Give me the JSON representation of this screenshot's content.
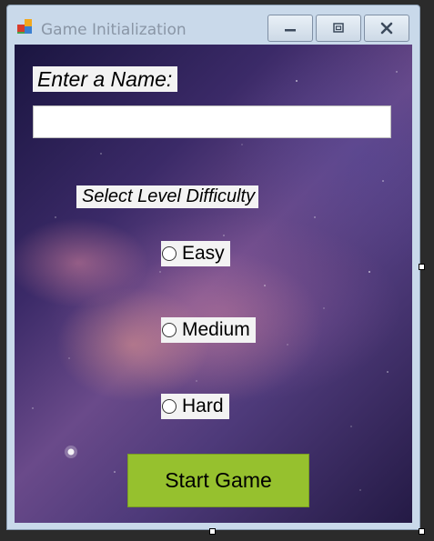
{
  "window": {
    "title": "Game Initialization",
    "icon": "winforms-app-icon",
    "controls": [
      "minimize-icon",
      "maximize-icon",
      "close-icon"
    ]
  },
  "form": {
    "name_label": "Enter a Name:",
    "name_input": {
      "value": "",
      "placeholder": ""
    },
    "difficulty_label": "Select Level Difficulty",
    "difficulty_options": [
      {
        "label": "Easy",
        "selected": false
      },
      {
        "label": "Medium",
        "selected": false
      },
      {
        "label": "Hard",
        "selected": false
      }
    ],
    "start_button_label": "Start Game"
  },
  "colors": {
    "start_button": "#96c12e",
    "label_background": "#f3f3f3",
    "window_frame": "#c9d9ea"
  }
}
